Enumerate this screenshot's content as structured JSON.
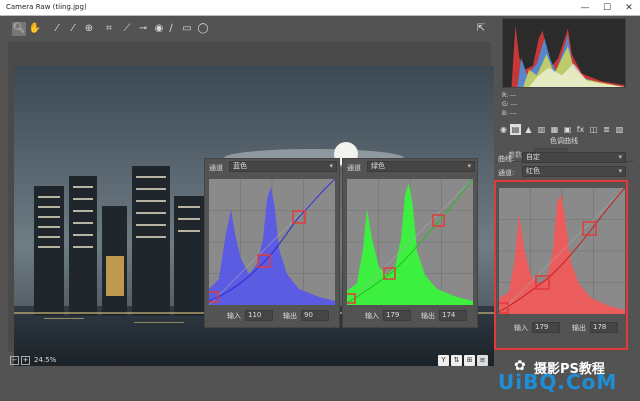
{
  "window": {
    "title": "Camera Raw (tiing.jpg)",
    "min": "—",
    "max": "☐",
    "close": "✕"
  },
  "toolbar": {
    "tools": [
      "zoom-icon",
      "hand-icon",
      "white-balance-icon",
      "color-sampler-icon",
      "targeted-adjust-icon",
      "crop-icon",
      "straighten-icon",
      "spot-removal-icon",
      "red-eye-icon",
      "adjustment-brush-icon",
      "graduated-filter-icon",
      "radial-filter-icon"
    ],
    "open_prefs_icon": "preferences-icon"
  },
  "curves": {
    "channel_label": "通道",
    "blue": {
      "channel": "蓝色",
      "input_label": "输入",
      "input": "110",
      "output_label": "输出",
      "output": "90"
    },
    "green": {
      "channel": "绿色",
      "input_label": "输入",
      "input": "179",
      "output_label": "输出",
      "output": "174"
    },
    "red": {
      "channel": "红色",
      "input_label": "输入",
      "input": "179",
      "output_label": "输出",
      "output": "178"
    }
  },
  "bottom": {
    "zoom": "24.5%",
    "minus": "−",
    "plus": "+"
  },
  "right": {
    "readout": {
      "r": "R:",
      "g": "G:",
      "b": "B:",
      "r_val": "---",
      "g_val": "---",
      "b_val": "---"
    },
    "panel_title": "色调曲线",
    "tab_param": "参数",
    "tab_point": "点",
    "curve_label": "曲线:",
    "curve_value": "自定",
    "channel_label": "通道:",
    "channel_value": "红色"
  },
  "watermark": {
    "brand": "摄影PS教程",
    "site": "UiBQ.CoM"
  },
  "colors": {
    "blue_hist": "#5a5ae8",
    "green_hist": "#39f53b",
    "red_hist": "#f05a5a",
    "highlight": "#e23a3a"
  }
}
